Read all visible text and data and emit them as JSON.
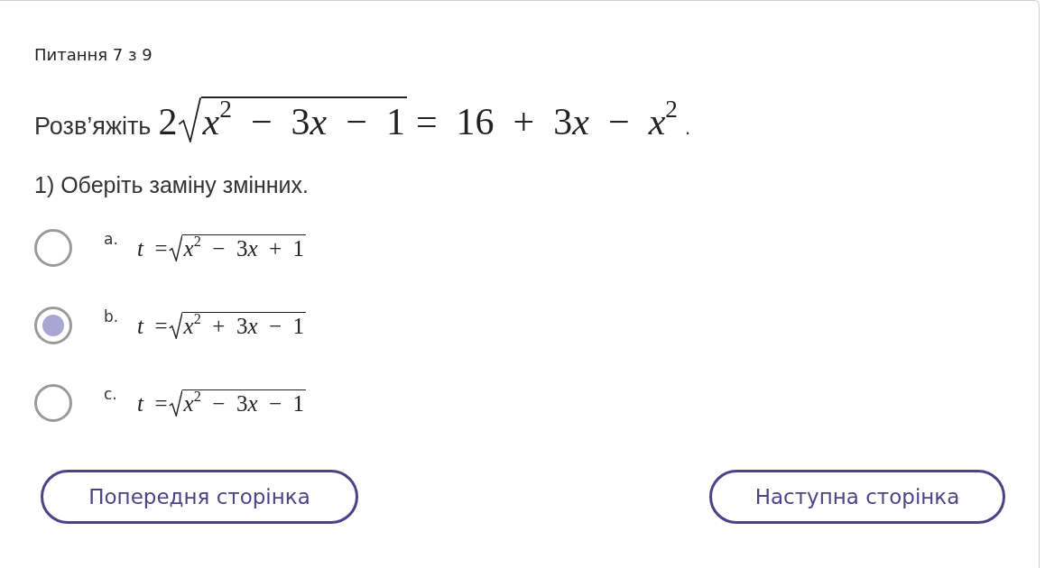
{
  "question_counter": "Питання 7 з 9",
  "question": {
    "prefix": "Розв’яжіть",
    "formula": {
      "before": "2",
      "radicand": "x$^{2}$ − 3x − 1",
      "after": "= 16 + 3x − x$^{2}$"
    },
    "suffix": "."
  },
  "subquestion": "1) Оберіть заміну змінних.",
  "options": [
    {
      "label": "a.",
      "formula": {
        "before": "t =",
        "radicand": "x$^{2}$ − 3x + 1"
      },
      "selected": false
    },
    {
      "label": "b.",
      "formula": {
        "before": "t =",
        "radicand": "x$^{2}$ + 3x − 1"
      },
      "selected": true
    },
    {
      "label": "c.",
      "formula": {
        "before": "t =",
        "radicand": "x$^{2}$ − 3x − 1"
      },
      "selected": false
    }
  ],
  "buttons": [
    {
      "label": "Попередня сторінка"
    },
    {
      "label": "Наступна сторінка"
    }
  ]
}
